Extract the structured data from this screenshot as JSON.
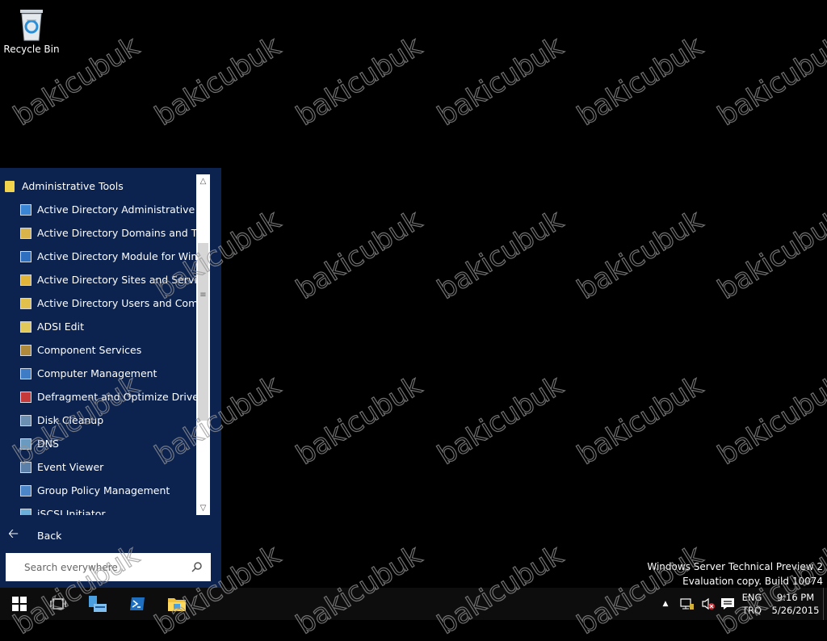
{
  "desktop": {
    "recycle_bin_label": "Recycle Bin",
    "version_line1": "Windows Server Technical Preview 2",
    "version_line2": "Evaluation copy. Build 10074",
    "watermark": "bakicubuk"
  },
  "start_menu": {
    "group_header": "Administrative Tools",
    "items": [
      {
        "label": "Active Directory Administrative Center",
        "icon": "ad-admin-center-icon"
      },
      {
        "label": "Active Directory Domains and Trusts",
        "icon": "ad-domains-trusts-icon"
      },
      {
        "label": "Active Directory Module for Windows PowerShell",
        "icon": "ad-powershell-module-icon"
      },
      {
        "label": "Active Directory Sites and Services",
        "icon": "ad-sites-services-icon"
      },
      {
        "label": "Active Directory Users and Computers",
        "icon": "ad-users-computers-icon"
      },
      {
        "label": "ADSI Edit",
        "icon": "adsi-edit-icon"
      },
      {
        "label": "Component Services",
        "icon": "component-services-icon"
      },
      {
        "label": "Computer Management",
        "icon": "computer-management-icon"
      },
      {
        "label": "Defragment and Optimize Drives",
        "icon": "defragment-icon"
      },
      {
        "label": "Disk Cleanup",
        "icon": "disk-cleanup-icon"
      },
      {
        "label": "DNS",
        "icon": "dns-icon"
      },
      {
        "label": "Event Viewer",
        "icon": "event-viewer-icon"
      },
      {
        "label": "Group Policy Management",
        "icon": "group-policy-icon"
      },
      {
        "label": "iSCSI Initiator",
        "icon": "iscsi-icon"
      }
    ],
    "back_label": "Back",
    "search_placeholder": "Search everywhere"
  },
  "taskbar": {
    "buttons": [
      "start-button",
      "task-view-button",
      "server-manager-button",
      "powershell-button",
      "file-explorer-button"
    ],
    "language_line1": "ENG",
    "language_line2": "TRQ",
    "time": "9:16 PM",
    "date": "5/26/2015"
  },
  "colors": {
    "start_menu_bg": "#0c2350",
    "taskbar_bg": "#0d0d0d",
    "desktop_bg": "#000000"
  }
}
